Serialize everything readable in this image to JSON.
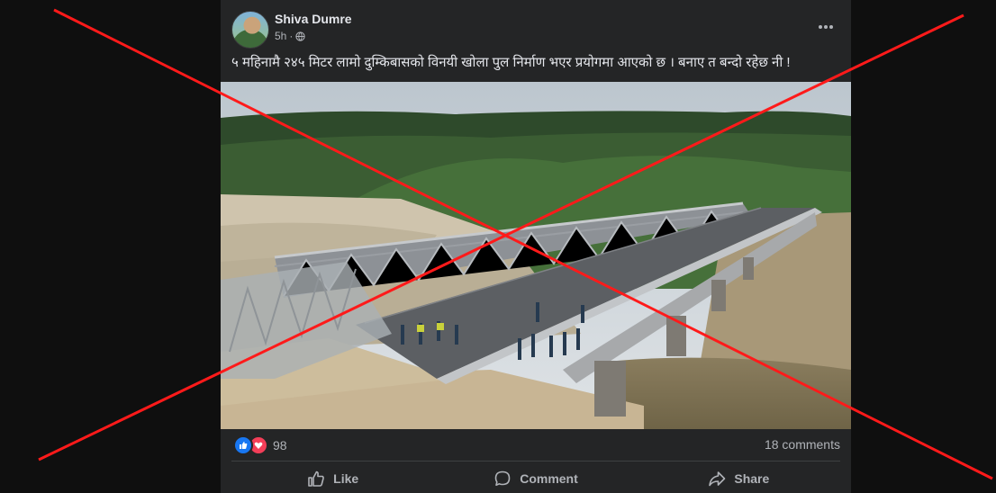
{
  "post": {
    "author": "Shiva Dumre",
    "time": "5h",
    "separator": "·",
    "caption": "५ महिनामै २४५ मिटर लामो दुम्किबासको विनयी खोला पुल निर्माण भएर प्रयोगमा आएको छ । बनाए त बन्दो रहेछ नी !",
    "reaction_count": "98",
    "comments_count": "18 comments",
    "actions": {
      "like": "Like",
      "comment": "Comment",
      "share": "Share"
    }
  },
  "colors": {
    "cross": "#ff1a1a",
    "like_blue": "#1877f2",
    "love_red": "#f33e58"
  },
  "icons": [
    "globe-icon",
    "more-options-icon",
    "like-reaction-icon",
    "love-reaction-icon",
    "like-icon",
    "comment-icon",
    "share-icon"
  ]
}
